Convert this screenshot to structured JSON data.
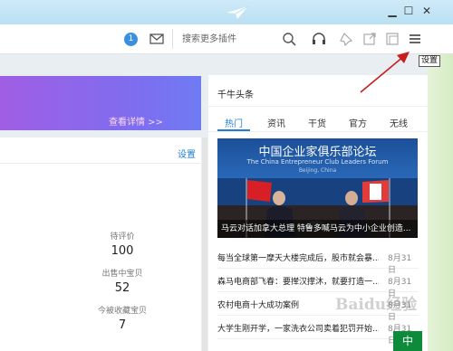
{
  "window": {
    "min": "▁",
    "max": "☐",
    "close": "✕"
  },
  "toolbar": {
    "avatar_badge": "1",
    "search_placeholder": "搜索更多插件",
    "tooltip": "设置"
  },
  "banner": {
    "link": "查看详情 >>"
  },
  "panel": {
    "settings": "设置",
    "stats": [
      {
        "label": "待评价",
        "value": "100"
      },
      {
        "label": "出售中宝贝",
        "value": "52"
      },
      {
        "label": "今被收藏宝贝",
        "value": "7"
      }
    ]
  },
  "news": {
    "title": "千牛头条",
    "tabs": [
      "热门",
      "资讯",
      "干货",
      "官方",
      "无线"
    ],
    "hero": {
      "title_cn": "中国企业家俱乐部论坛",
      "title_en": "The China Entrepreneur Club Leaders Forum",
      "city": "Beijing, China",
      "caption": "马云对话加拿大总理 特鲁多喊马云为中小企业创造..."
    },
    "items": [
      {
        "title": "每当全球第一摩天大楼完成后，股市就会暴...",
        "date": "8月31日"
      },
      {
        "title": "森马电商部飞春：要撵汉撑沐，就要打造一...",
        "date": "8月31日"
      },
      {
        "title": "农村电商十大成功案例",
        "date": "8月31日"
      },
      {
        "title": "大学生刚开学，一家洗衣公司卖着犯罚开始...",
        "date": "8月31日"
      }
    ]
  },
  "watermark": "Baidu经验",
  "corner_badge": "中",
  "colors": {
    "accent": "#1d7fd6",
    "banner_start": "#a05ee4",
    "banner_end": "#6f7bf3",
    "arrow": "#c81e1e"
  }
}
